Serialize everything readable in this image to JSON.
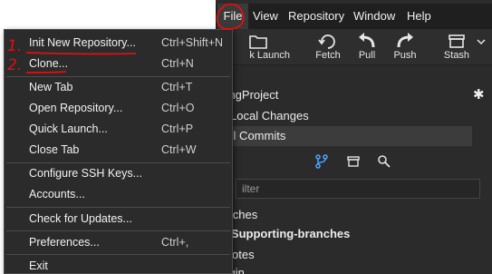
{
  "menubar": {
    "items": [
      "File",
      "View",
      "Repository",
      "Window",
      "Help"
    ]
  },
  "toolbar": {
    "quick_launch": "k Launch",
    "fetch": "Fetch",
    "pull": "Pull",
    "push": "Push",
    "stash": "Stash"
  },
  "sidebar": {
    "repo_title": "pringProject",
    "local_changes": "Local Changes",
    "all_commits": "All Commits",
    "filter_placeholder": "ilter",
    "branches_header": "ranches",
    "selected_branch": "Supporting-branches",
    "remotes_header": "emotes",
    "origin": "origin"
  },
  "file_menu": {
    "items": [
      {
        "label": "Init New Repository...",
        "shortcut": "Ctrl+Shift+N"
      },
      {
        "label": "Clone...",
        "shortcut": "Ctrl+N"
      },
      {
        "label": "New Tab",
        "shortcut": "Ctrl+T"
      },
      {
        "label": "Open Repository...",
        "shortcut": "Ctrl+O"
      },
      {
        "label": "Quick Launch...",
        "shortcut": "Ctrl+P"
      },
      {
        "label": "Close Tab",
        "shortcut": "Ctrl+W"
      },
      {
        "label": "Configure SSH Keys...",
        "shortcut": ""
      },
      {
        "label": "Accounts...",
        "shortcut": ""
      },
      {
        "label": "Check for Updates...",
        "shortcut": ""
      },
      {
        "label": "Preferences...",
        "shortcut": "Ctrl+,"
      },
      {
        "label": "Exit",
        "shortcut": ""
      }
    ]
  },
  "annotations": {
    "step1": "1.",
    "step2": "2."
  },
  "colors": {
    "annotation": "#e01010",
    "menu_bg": "#2b2b2b",
    "accent_icon": "#4da3ff"
  }
}
